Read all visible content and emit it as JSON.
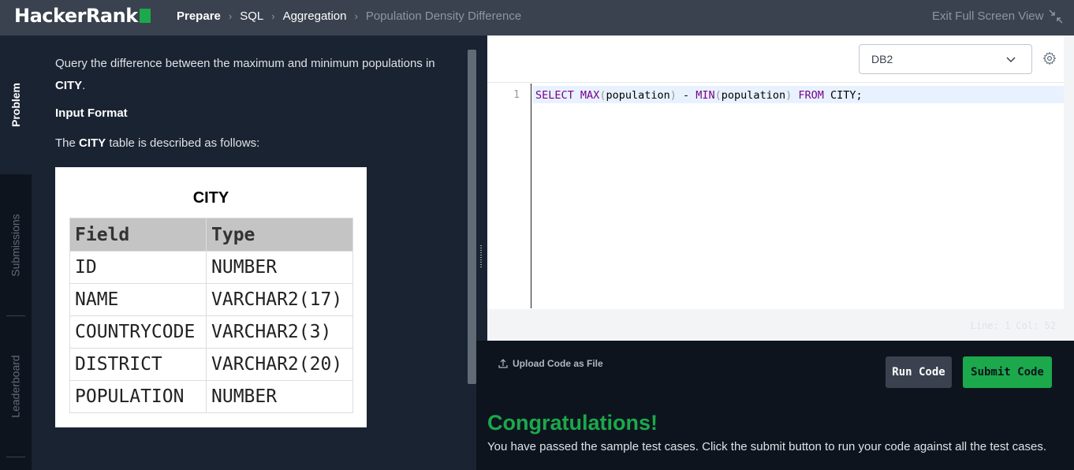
{
  "header": {
    "logo_text": "HackerRank",
    "breadcrumbs": [
      "Prepare",
      "SQL",
      "Aggregation",
      "Population Density Difference"
    ],
    "exit_fullscreen": "Exit Full Screen View"
  },
  "side_tabs": [
    "Problem",
    "Submissions",
    "Leaderboard"
  ],
  "problem": {
    "statement_pre": "Query the difference between the maximum and minimum populations in ",
    "statement_bold": "CITY",
    "statement_post": ".",
    "input_format_heading": "Input Format",
    "table_desc_pre": "The ",
    "table_desc_bold": "CITY",
    "table_desc_post": " table is described as follows:",
    "table_image": {
      "title": "CITY",
      "headers": [
        "Field",
        "Type"
      ],
      "rows": [
        [
          "ID",
          "NUMBER"
        ],
        [
          "NAME",
          "VARCHAR2(17)"
        ],
        [
          "COUNTRYCODE",
          "VARCHAR2(3)"
        ],
        [
          "DISTRICT",
          "VARCHAR2(20)"
        ],
        [
          "POPULATION",
          "NUMBER"
        ]
      ]
    }
  },
  "editor": {
    "language": "DB2",
    "line_number": "1",
    "code_tokens": {
      "select": "SELECT",
      "max": "MAX",
      "arg1": "population",
      "minus": " - ",
      "min": "MIN",
      "arg2": "population",
      "from": "FROM",
      "table": " CITY;"
    },
    "cursor_position": "Line: 1 Col: 52"
  },
  "actions": {
    "upload_label": "Upload Code as File",
    "run_label": "Run Code",
    "submit_label": "Submit Code"
  },
  "result": {
    "title": "Congratulations!",
    "message": "You have passed the sample test cases. Click the submit button to run your code against all the test cases."
  },
  "colors": {
    "brand_green": "#1ba94c",
    "topbar": "#39424e",
    "dark_bg": "#0e141e",
    "panel_bg": "#1a2332"
  }
}
